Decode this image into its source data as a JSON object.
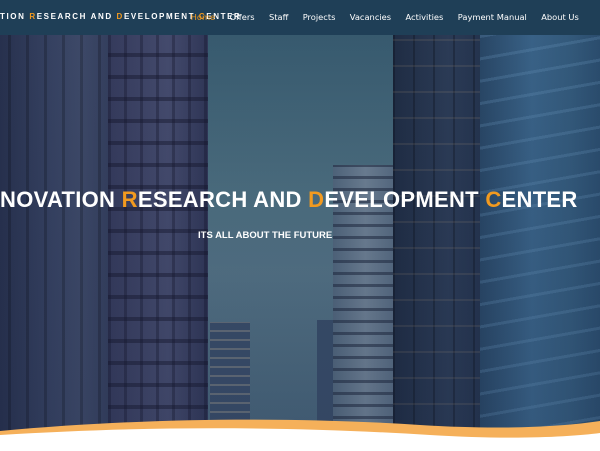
{
  "brand": {
    "parts": [
      {
        "text": "TION ",
        "accent": false
      },
      {
        "text": "R",
        "accent": true
      },
      {
        "text": "ESEARCH AND ",
        "accent": false
      },
      {
        "text": "D",
        "accent": true
      },
      {
        "text": "EVELOPMENT ",
        "accent": false
      },
      {
        "text": "C",
        "accent": true
      },
      {
        "text": "ENTER",
        "accent": false
      }
    ]
  },
  "nav": {
    "items": [
      "Home",
      "Offers",
      "Staff",
      "Projects",
      "Vacancies",
      "Activities",
      "Payment Manual",
      "About Us"
    ],
    "active": "Home"
  },
  "hero": {
    "title_parts": [
      {
        "text": "NOVATION ",
        "accent": false
      },
      {
        "text": "R",
        "accent": true
      },
      {
        "text": "ESEARCH AND ",
        "accent": false
      },
      {
        "text": "D",
        "accent": true
      },
      {
        "text": "EVELOPMENT ",
        "accent": false
      },
      {
        "text": "C",
        "accent": true
      },
      {
        "text": "ENTER",
        "accent": false
      }
    ],
    "subtitle": "ITS ALL ABOUT THE FUTURE"
  },
  "colors": {
    "header_bg": "#1f3f57",
    "accent": "#f29a1f",
    "wave": "#f5b05a"
  }
}
